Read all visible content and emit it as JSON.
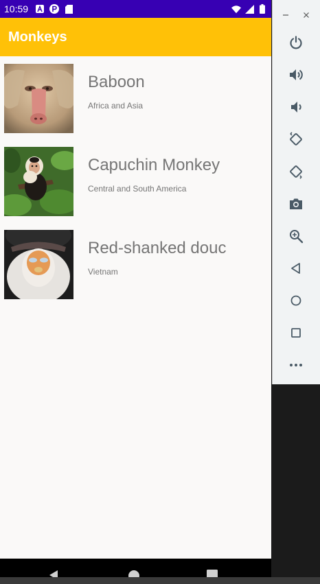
{
  "status_bar": {
    "time": "10:59",
    "left_icons": [
      "notification-a-icon",
      "notification-p-icon",
      "sd-card-icon"
    ],
    "right_icons": [
      "wifi-icon",
      "cell-signal-icon",
      "battery-icon"
    ],
    "color": "#3700b3"
  },
  "app_bar": {
    "title": "Monkeys",
    "color": "#ffc107"
  },
  "monkeys": [
    {
      "name": "Baboon",
      "location": "Africa and Asia",
      "image": "baboon-photo"
    },
    {
      "name": "Capuchin Monkey",
      "location": "Central and South America",
      "image": "capuchin-photo"
    },
    {
      "name": "Red-shanked douc",
      "location": "Vietnam",
      "image": "douc-photo"
    }
  ],
  "nav_bar": {
    "buttons": [
      "back-icon",
      "home-icon",
      "recents-icon"
    ]
  },
  "emulator_toolbar": {
    "window_buttons": [
      "minimize-icon",
      "close-icon"
    ],
    "buttons": [
      "power-icon",
      "volume-up-icon",
      "volume-down-icon",
      "rotate-left-icon",
      "rotate-right-icon",
      "camera-icon",
      "zoom-icon",
      "back-icon",
      "home-icon",
      "overview-icon",
      "more-icon"
    ]
  }
}
